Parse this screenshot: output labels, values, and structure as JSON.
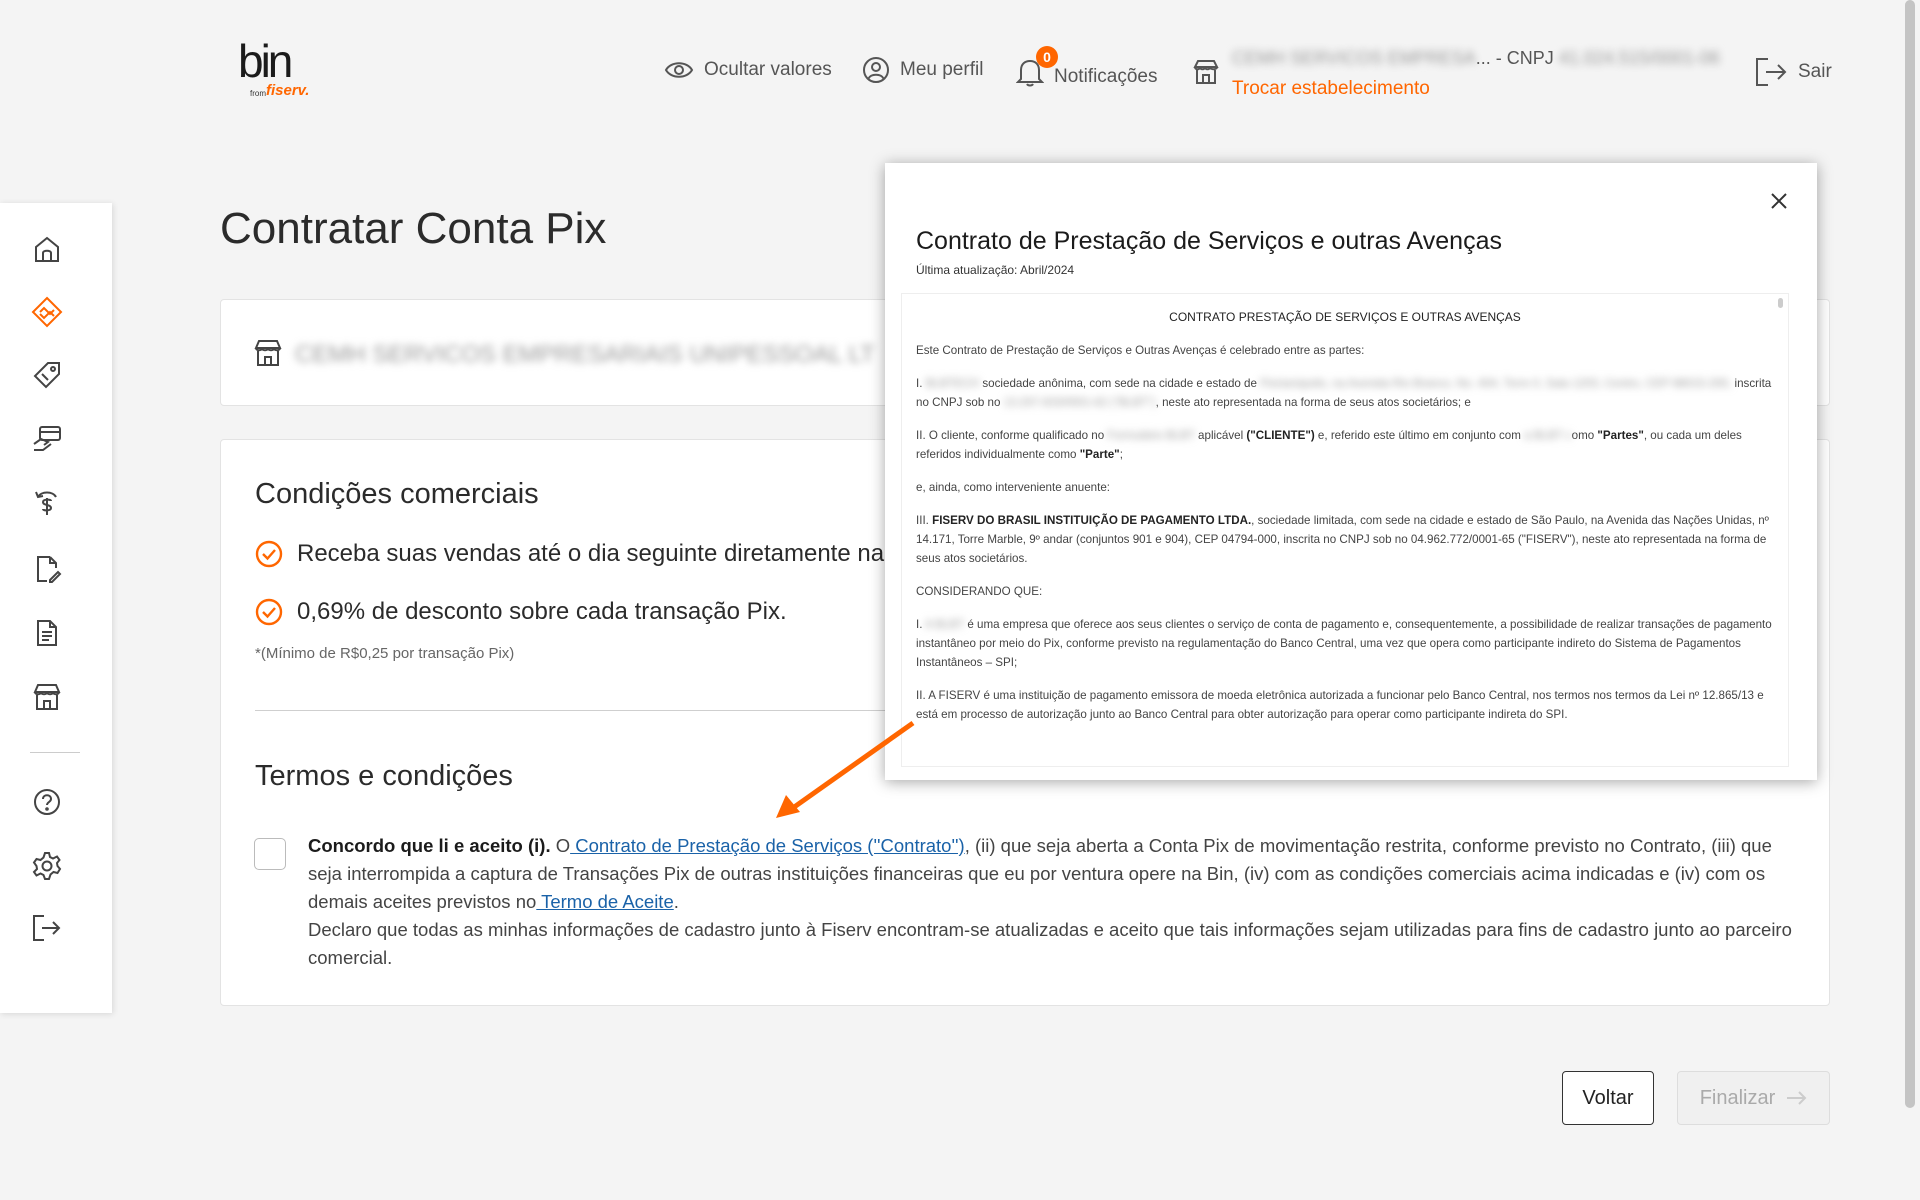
{
  "header": {
    "logo_text": "bin",
    "logo_from": "from",
    "logo_brand": "fiserv.",
    "hide_values": "Ocultar valores",
    "profile": "Meu perfil",
    "notif_count": "0",
    "notifications": "Notificações",
    "establishment_name": "CEMH SERVICOS EMPRESA",
    "establishment_suffix": "... - CNPJ",
    "establishment_cnpj": "41.024.515/0001-06",
    "change_establishment": "Trocar estabelecimento",
    "logout": "Sair"
  },
  "sidebar": {
    "items": [
      "home-icon",
      "pix-icon",
      "price-tag-icon",
      "card-hand-icon",
      "refund-icon",
      "document-edit-icon",
      "document-icon",
      "store-icon",
      "help-icon",
      "settings-icon",
      "logout-icon"
    ],
    "active_index": 1,
    "accent": "#ff6600"
  },
  "main": {
    "title": "Contratar Conta Pix",
    "establishment_full": "CEMH SERVICOS EMPRESARIAIS UNIPESSOAL LT",
    "conditions_title": "Condições comerciais",
    "condition_1": "Receba suas vendas até o dia seguinte diretamente na",
    "condition_2": "0,69% de desconto sobre cada transação Pix.",
    "min_note": "*(Mínimo de R$0,25 por transação Pix)",
    "terms_title": "Termos e condições",
    "terms_agree": "Concordo que li e aceito (i).",
    "terms_o": " O",
    "terms_contract_link": " Contrato de Prestação de Serviços (''Contrato'')",
    "terms_rest": ", (ii) que seja aberta a Conta Pix de movimentação restrita, conforme previsto no Contrato, (iii) que seja interrompida a captura de Transações Pix de outras instituições financeiras que eu por ventura opere na Bin, (iv) com as condições comerciais acima indicadas e (iv) com os demais aceites previstos no",
    "terms_accept_link": " Termo de Aceite",
    "terms_period": ".",
    "terms_declare": "Declaro que todas as minhas informações de cadastro junto à Fiserv encontram-se atualizadas e aceito que tais informações sejam utilizadas para fins de cadastro junto ao parceiro comercial.",
    "back_button": "Voltar",
    "finish_button": "Finalizar"
  },
  "modal": {
    "title": "Contrato de Prestação de Serviços e outras Avenças",
    "subtitle": "Última atualização: Abril/2024",
    "doc_heading": "CONTRATO PRESTAÇÃO DE SERVIÇOS E OUTRAS AVENÇAS",
    "p1": "Este Contrato de Prestação de Serviços e Outras Avenças é celebrado entre as partes:",
    "p2_a": "I. ",
    "p2_blur1": "BLBTECH",
    "p2_b": " sociedade anônima, com sede na cidade e estado de ",
    "p2_blur2": "Florianópolis, na Avenida Rio Branco, No. 404, Torre II, Sala 1203, Centro, CEP 88015-200,",
    "p2_c": " inscrita no CNPJ sob no ",
    "p2_blur3": "13.207.633/0001-62 (\"BLBT\")",
    "p2_d": ", neste ato representada na forma de seus atos societários; e",
    "p3_a": "II. O cliente, conforme qualificado no ",
    "p3_blur1": "Formulário BLBT",
    "p3_b": " aplicável ",
    "p3_bold1": "(\"CLIENTE\")",
    "p3_c": " e, referido este último em conjunto com ",
    "p3_blur2": "a BLBT c",
    "p3_d": "omo ",
    "p3_bold2": "\"Partes\"",
    "p3_e": ", ou cada um deles referidos individualmente como ",
    "p3_bold3": "\"Parte\"",
    "p3_f": ";",
    "p4": "e, ainda, como interveniente anuente:",
    "p5_a": "III. ",
    "p5_bold": "FISERV DO BRASIL INSTITUIÇÃO DE PAGAMENTO LTDA.",
    "p5_b": ", sociedade limitada, com sede na cidade e estado de São Paulo, na Avenida das Nações Unidas, nº 14.171, Torre Marble, 9º andar (conjuntos 901 e 904), CEP 04794-000, inscrita no CNPJ sob no 04.962.772/0001-65 (\"FISERV\"), neste ato representada na forma de seus atos societários.",
    "p6": "CONSIDERANDO QUE:",
    "p7_a": "I. ",
    "p7_blur": "A BLBT",
    "p7_b": " é uma empresa que oferece aos seus clientes o serviço de conta de pagamento e, consequentemente, a possibilidade de realizar transações de pagamento instantâneo por meio do Pix, conforme previsto na regulamentação do Banco Central, uma vez que opera como participante indireto do Sistema de Pagamentos Instantâneos – SPI;",
    "p8": "II. A FISERV é uma instituição de pagamento emissora de moeda eletrônica autorizada a funcionar pelo Banco Central, nos termos nos termos da Lei nº 12.865/13 e está em processo de autorização junto ao Banco Central para obter autorização para operar como participante indireta do SPI."
  }
}
